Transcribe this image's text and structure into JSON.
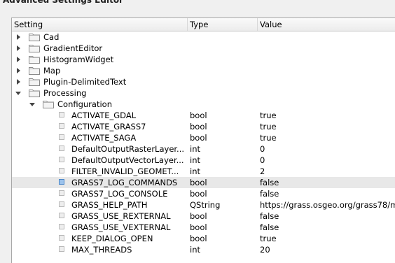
{
  "window": {
    "title": "Advanced Settings Editor"
  },
  "columns": {
    "setting": "Setting",
    "type": "Type",
    "value": "Value"
  },
  "groups": [
    {
      "label": "Cad",
      "expanded": false
    },
    {
      "label": "GradientEditor",
      "expanded": false
    },
    {
      "label": "HistogramWidget",
      "expanded": false
    },
    {
      "label": "Map",
      "expanded": false
    },
    {
      "label": "Plugin-DelimitedText",
      "expanded": false
    },
    {
      "label": "Processing",
      "expanded": true
    },
    {
      "label": "Configuration",
      "expanded": true
    }
  ],
  "settings": [
    {
      "name": "ACTIVATE_GDAL",
      "type": "bool",
      "value": "true"
    },
    {
      "name": "ACTIVATE_GRASS7",
      "type": "bool",
      "value": "true"
    },
    {
      "name": "ACTIVATE_SAGA",
      "type": "bool",
      "value": "true"
    },
    {
      "name": "DefaultOutputRasterLayer...",
      "type": "int",
      "value": "0"
    },
    {
      "name": "DefaultOutputVectorLayer...",
      "type": "int",
      "value": "0"
    },
    {
      "name": "FILTER_INVALID_GEOMET...",
      "type": "int",
      "value": "2"
    },
    {
      "name": "GRASS7_LOG_COMMANDS",
      "type": "bool",
      "value": "false",
      "selected": true
    },
    {
      "name": "GRASS7_LOG_CONSOLE",
      "type": "bool",
      "value": "false"
    },
    {
      "name": "GRASS_HELP_PATH",
      "type": "QString",
      "value": "https://grass.osgeo.org/grass78/m"
    },
    {
      "name": "GRASS_USE_REXTERNAL",
      "type": "bool",
      "value": "false"
    },
    {
      "name": "GRASS_USE_VEXTERNAL",
      "type": "bool",
      "value": "false"
    },
    {
      "name": "KEEP_DIALOG_OPEN",
      "type": "bool",
      "value": "true"
    },
    {
      "name": "MAX_THREADS",
      "type": "int",
      "value": "20"
    }
  ],
  "icons": {
    "folder": "folder-icon",
    "expand": "chevron-right-icon",
    "collapse": "chevron-down-icon",
    "leaf": "setting-leaf-icon"
  },
  "colors": {
    "selected_row": "#e8e8e8",
    "selected_leaf": "#9cc3ec"
  }
}
